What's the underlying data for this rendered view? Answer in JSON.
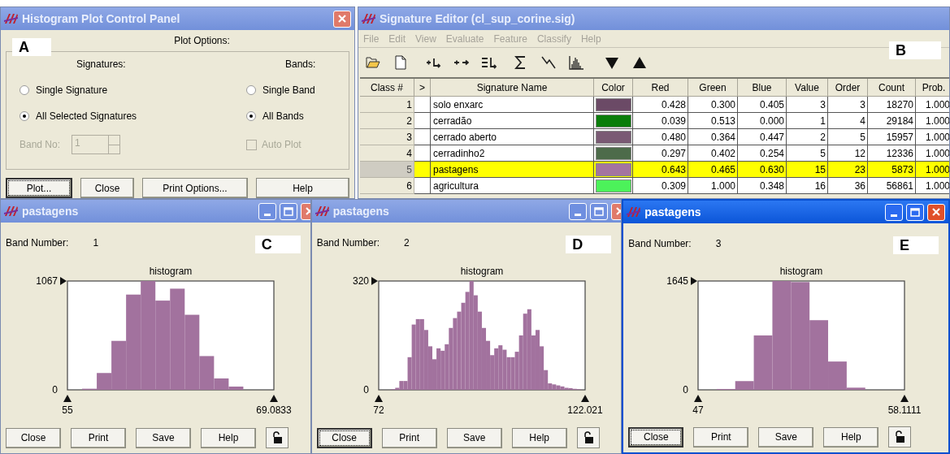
{
  "histogram_control_panel": {
    "title": "Histogram Plot Control Panel",
    "active": false,
    "annotation": "A",
    "plot_options_label": "Plot Options:",
    "signatures": {
      "label": "Signatures:",
      "options": [
        {
          "label": "Single Signature",
          "selected": false
        },
        {
          "label": "All Selected Signatures",
          "selected": true
        }
      ]
    },
    "bands": {
      "label": "Bands:",
      "options": [
        {
          "label": "Single Band",
          "selected": false
        },
        {
          "label": "All Bands",
          "selected": true
        }
      ]
    },
    "band_no": {
      "label": "Band No:",
      "value": "1",
      "disabled": true
    },
    "auto_plot": {
      "label": "Auto Plot",
      "checked": false,
      "disabled": true
    },
    "buttons": [
      {
        "label": "Plot...",
        "focused": true
      },
      {
        "label": "Close",
        "focused": false
      },
      {
        "label": "Print Options...",
        "focused": false
      },
      {
        "label": "Help",
        "focused": false
      }
    ]
  },
  "signature_editor": {
    "title": "Signature Editor (cl_sup_corine.sig)",
    "active": false,
    "annotation": "B",
    "menu": [
      {
        "label": "File",
        "disabled": true
      },
      {
        "label": "Edit",
        "disabled": true
      },
      {
        "label": "View",
        "disabled": true
      },
      {
        "label": "Evaluate",
        "disabled": true
      },
      {
        "label": "Feature",
        "disabled": true
      },
      {
        "label": "Classify",
        "disabled": true
      },
      {
        "label": "Help",
        "disabled": true
      }
    ],
    "table": {
      "columns": [
        "Class #",
        ">",
        "Signature Name",
        "Color",
        "Red",
        "Green",
        "Blue",
        "Value",
        "Order",
        "Count",
        "Prob."
      ],
      "rows": [
        {
          "class": "1",
          "name": "solo enxarc",
          "color": "#6b4a66",
          "red": "0.428",
          "green": "0.300",
          "blue": "0.405",
          "value": "3",
          "order": "3",
          "count": "18270",
          "prob": "1.000",
          "selected": false
        },
        {
          "class": "2",
          "name": "cerradão",
          "color": "#0a7d0a",
          "red": "0.039",
          "green": "0.513",
          "blue": "0.000",
          "value": "1",
          "order": "4",
          "count": "29184",
          "prob": "1.000",
          "selected": false
        },
        {
          "class": "3",
          "name": "cerrado aberto",
          "color": "#7a5a74",
          "red": "0.480",
          "green": "0.364",
          "blue": "0.447",
          "value": "2",
          "order": "5",
          "count": "15957",
          "prob": "1.000",
          "selected": false
        },
        {
          "class": "4",
          "name": "cerradinho2",
          "color": "#4d6b4a",
          "red": "0.297",
          "green": "0.402",
          "blue": "0.254",
          "value": "5",
          "order": "12",
          "count": "12336",
          "prob": "1.000",
          "selected": false
        },
        {
          "class": "5",
          "name": "pastagens",
          "color": "#a474a0",
          "red": "0.643",
          "green": "0.465",
          "blue": "0.630",
          "value": "15",
          "order": "23",
          "count": "5873",
          "prob": "1.000",
          "selected": true
        },
        {
          "class": "6",
          "name": "agricultura",
          "color": "#4cf25a",
          "red": "0.309",
          "green": "1.000",
          "blue": "0.348",
          "value": "16",
          "order": "36",
          "count": "56861",
          "prob": "1.000",
          "selected": false
        }
      ]
    }
  },
  "histogram_windows": [
    {
      "title": "pastagens",
      "active": false,
      "annotation": "C",
      "band_label": "Band Number:",
      "band_number": "1",
      "chart_data": {
        "type": "bar",
        "title": "histogram",
        "x": [
          55.5,
          56.5,
          57.5,
          58.5,
          59.5,
          60.5,
          61.5,
          62.5,
          63.5,
          64.5,
          65.5,
          66.5,
          67.5,
          68.5
        ],
        "values": [
          0,
          11,
          165,
          480,
          934,
          1067,
          875,
          992,
          736,
          331,
          112,
          32,
          0,
          0
        ],
        "xlim": [
          55,
          69.0833
        ],
        "ylim": [
          0,
          1067
        ],
        "xticks": [
          55,
          69.0833
        ],
        "yticks": [
          0,
          1067
        ]
      },
      "buttons": [
        {
          "label": "Close",
          "focused": false
        },
        {
          "label": "Print",
          "focused": false
        },
        {
          "label": "Save",
          "focused": false
        },
        {
          "label": "Help",
          "focused": false
        }
      ]
    },
    {
      "title": "pastagens",
      "active": false,
      "annotation": "D",
      "band_label": "Band Number:",
      "band_number": "2",
      "chart_data": {
        "type": "bar",
        "title": "histogram",
        "x": [
          72.5,
          73.5,
          74.5,
          75.5,
          76.5,
          77.5,
          78.5,
          79.5,
          80.5,
          81.5,
          82.5,
          83.5,
          84.5,
          85.5,
          86.5,
          87.5,
          88.5,
          89.5,
          90.5,
          91.5,
          92.5,
          93.5,
          94.5,
          95.5,
          96.5,
          97.5,
          98.5,
          99.5,
          100.5,
          101.5,
          102.5,
          103.5,
          104.5,
          105.5,
          106.5,
          107.5,
          108.5,
          109.5,
          110.5,
          111.5,
          112.5,
          113.5,
          114.5,
          115.5,
          116.5,
          117.5,
          118.5,
          119.5,
          120.5,
          121.5
        ],
        "values": [
          0,
          0,
          0,
          2,
          6,
          26,
          26,
          96,
          192,
          208,
          208,
          176,
          128,
          90,
          122,
          115,
          134,
          182,
          211,
          230,
          256,
          288,
          320,
          278,
          230,
          182,
          144,
          102,
          122,
          131,
          118,
          96,
          96,
          112,
          160,
          224,
          237,
          160,
          176,
          128,
          58,
          19,
          16,
          13,
          10,
          6,
          5,
          3,
          2,
          0
        ],
        "xlim": [
          72,
          122.021
        ],
        "ylim": [
          0,
          320
        ],
        "xticks": [
          72,
          122.021
        ],
        "yticks": [
          0,
          320
        ]
      },
      "buttons": [
        {
          "label": "Close",
          "focused": true
        },
        {
          "label": "Print",
          "focused": false
        },
        {
          "label": "Save",
          "focused": false
        },
        {
          "label": "Help",
          "focused": false
        }
      ]
    },
    {
      "title": "pastagens",
      "active": true,
      "annotation": "E",
      "band_label": "Band Number:",
      "band_number": "3",
      "chart_data": {
        "type": "bar",
        "title": "histogram",
        "x": [
          47.5,
          48.5,
          49.5,
          50.5,
          51.5,
          52.5,
          53.5,
          54.5,
          55.5,
          56.5,
          57.5
        ],
        "values": [
          0,
          13,
          132,
          822,
          1645,
          1629,
          1053,
          428,
          33,
          0,
          0
        ],
        "xlim": [
          47,
          58.1111
        ],
        "ylim": [
          0,
          1645
        ],
        "xticks": [
          47,
          58.1111
        ],
        "yticks": [
          0,
          1645
        ]
      },
      "buttons": [
        {
          "label": "Close",
          "focused": true
        },
        {
          "label": "Print",
          "focused": false
        },
        {
          "label": "Save",
          "focused": false
        },
        {
          "label": "Help",
          "focused": false
        }
      ]
    }
  ]
}
